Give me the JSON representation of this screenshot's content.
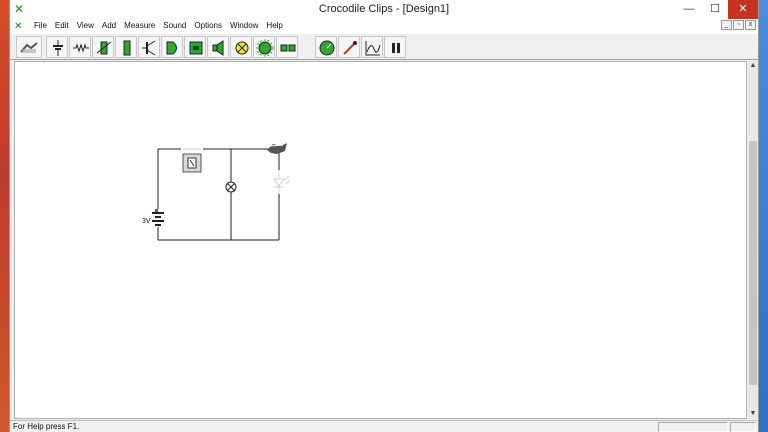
{
  "window": {
    "title": "Crocodile Clips - [Design1]",
    "controls": {
      "minimize": "—",
      "maximize": "☐",
      "close": "✕"
    }
  },
  "menu": {
    "items": [
      "File",
      "Edit",
      "View",
      "Add",
      "Measure",
      "Sound",
      "Options",
      "Window",
      "Help"
    ]
  },
  "mdi": {
    "minimize": "_",
    "restore": "▫",
    "close": "x"
  },
  "toolbar": {
    "tools": [
      "wire-tool",
      "power-supply-tool",
      "resistor-tool",
      "variable-resistor-tool",
      "capacitor-tool",
      "transistor-tool",
      "logic-gate-tool",
      "integrated-circuit-tool",
      "speaker-tool",
      "lamp-tool",
      "motor-tool",
      "switches-tool",
      "meter-tool",
      "probe-tool",
      "graph-tool",
      "pause-tool"
    ]
  },
  "circuit": {
    "battery_label": "3V"
  },
  "status": {
    "help_text": "For Help press F1."
  }
}
